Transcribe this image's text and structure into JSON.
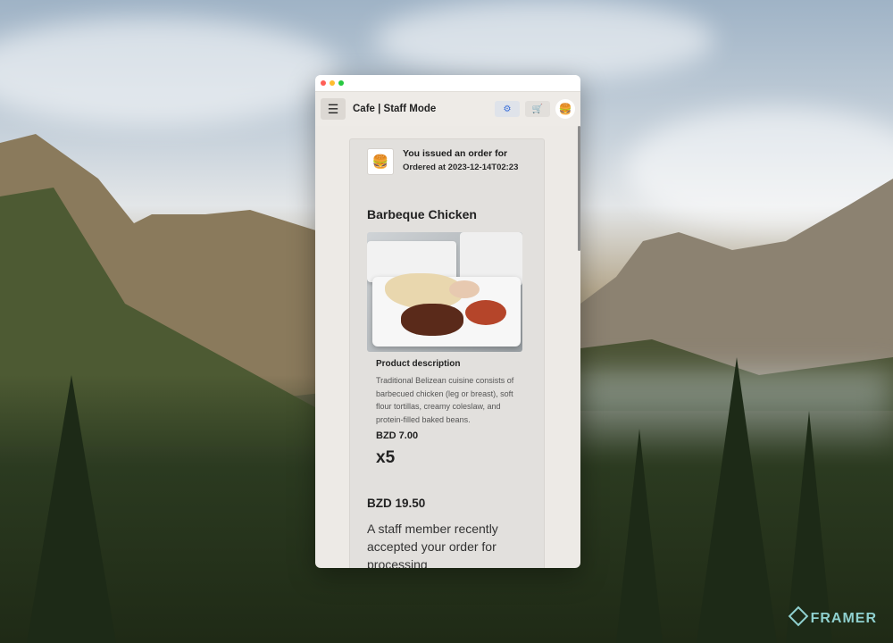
{
  "app": {
    "title": "Cafe | Staff Mode",
    "menu_icon": "hamburger-menu-icon",
    "actions": [
      {
        "name": "settings-gears-icon",
        "glyph": "⚙"
      },
      {
        "name": "cart-icon",
        "glyph": "🛒"
      }
    ],
    "avatar_icon": "burger-icon",
    "avatar_glyph": "🍔"
  },
  "window_controls": {
    "colors": [
      "#ff5f57",
      "#febc2e",
      "#28c840"
    ]
  },
  "order": {
    "notice_title": "You  issued an order for",
    "notice_time": "Ordered at 2023-12-14T02:23",
    "notice_icon": "🍔",
    "product_name": "Barbeque Chicken",
    "description_heading": "Product description",
    "description": "Traditional Belizean cuisine consists of barbecued chicken (leg or breast), soft flour tortillas, creamy coleslaw, and protein-filled baked beans.",
    "unit_price": "BZD 7.00",
    "quantity": "x5",
    "total": "BZD 19.50",
    "status_message": "A staff member recently accepted your order for processing"
  },
  "brand": {
    "watermark": "FRAMER"
  }
}
